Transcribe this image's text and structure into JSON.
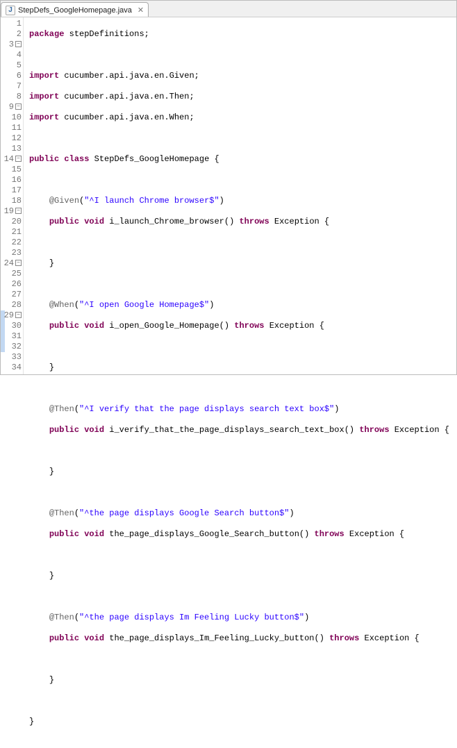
{
  "tab": {
    "filename": "StepDefs_GoogleHomepage.java",
    "icon_letter": "J"
  },
  "code": {
    "package_kw": "package",
    "package_name": " stepDefinitions;",
    "import_kw": "import",
    "import1": " cucumber.api.java.en.Given;",
    "import2": " cucumber.api.java.en.Then;",
    "import3": " cucumber.api.java.en.When;",
    "public_kw": "public",
    "class_kw": "class",
    "void_kw": "void",
    "throws_kw": "throws",
    "class_name": " StepDefs_GoogleHomepage {",
    "exception": " Exception {",
    "brace_close": "}",
    "ann_given": "@Given",
    "ann_when": "@When",
    "ann_then": "@Then",
    "str_given": "\"^I launch Chrome browser$\"",
    "str_when": "\"^I open Google Homepage$\"",
    "str_then1": "\"^I verify that the page displays search text box$\"",
    "str_then2": "\"^the page displays Google Search button$\"",
    "str_then3": "\"^the page displays Im Feeling Lucky button$\"",
    "m1": " i_launch_Chrome_browser() ",
    "m2": " i_open_Google_Homepage() ",
    "m3": " i_verify_that_the_page_displays_search_text_box() ",
    "m4": " the_page_displays_Google_Search_button() ",
    "m5": " the_page_displays_Im_Feeling_Lucky_button() ",
    "paren_open": "(",
    "paren_close": ")"
  },
  "lines": [
    "1",
    "2",
    "3",
    "4",
    "5",
    "6",
    "7",
    "8",
    "9",
    "10",
    "11",
    "12",
    "13",
    "14",
    "15",
    "16",
    "17",
    "18",
    "19",
    "20",
    "21",
    "22",
    "23",
    "24",
    "25",
    "26",
    "27",
    "28",
    "29",
    "30",
    "31",
    "32",
    "33",
    "34"
  ]
}
